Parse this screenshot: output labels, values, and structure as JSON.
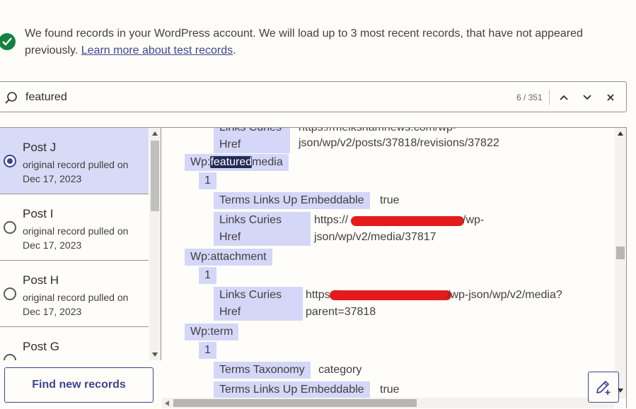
{
  "banner": {
    "message": "We found records in your WordPress account. We will load up to 3 most recent records, that have not appeared previously.",
    "link_text": "Learn more about test records",
    "trailing": "."
  },
  "search": {
    "value": "featured",
    "count": "6 / 351"
  },
  "records": [
    {
      "title": "Post J",
      "subtitle": "original record pulled on Dec 17, 2023",
      "selected": true
    },
    {
      "title": "Post I",
      "subtitle": "original record pulled on Dec 17, 2023",
      "selected": false
    },
    {
      "title": "Post H",
      "subtitle": "original record pulled on Dec 17, 2023",
      "selected": false
    },
    {
      "title": "Post G",
      "subtitle": "",
      "selected": false
    }
  ],
  "find_button": "Find new records",
  "tree": {
    "top_label": "Links Curies Href",
    "top_value_1": "https://melkshamnews.com/wp-",
    "top_value_2": "json/wp/v2/posts/37818/revisions/37822",
    "featured_prefix": "Wp:",
    "featured_match": "featured",
    "featured_suffix": "media",
    "index_1": "1",
    "embeddable_label": "Terms Links Up Embeddable",
    "embeddable_value": "true",
    "curies_label_a": "Links Curies",
    "curies_label_b": "Href",
    "media_value_1": "https://",
    "media_value_1_end": "/wp-",
    "media_value_2": "json/wp/v2/media/37817",
    "attachment": "Wp:attachment",
    "index_2": "1",
    "attach_value_1": "https://",
    "attach_value_1_end": "/wp-json/wp/v2/media?",
    "attach_value_2": "parent=37818",
    "term": "Wp:term",
    "index_3": "1",
    "taxonomy_label": "Terms Taxonomy",
    "taxonomy_value": "category",
    "embeddable_label_2": "Terms Links Up Embeddable",
    "embeddable_value_2": "true"
  },
  "colors": {
    "accent": "#3d4592",
    "success": "#14813f",
    "node_bg": "#d4d7f7",
    "selected_bg": "#d7dbf6",
    "redaction": "#e41b1b"
  }
}
